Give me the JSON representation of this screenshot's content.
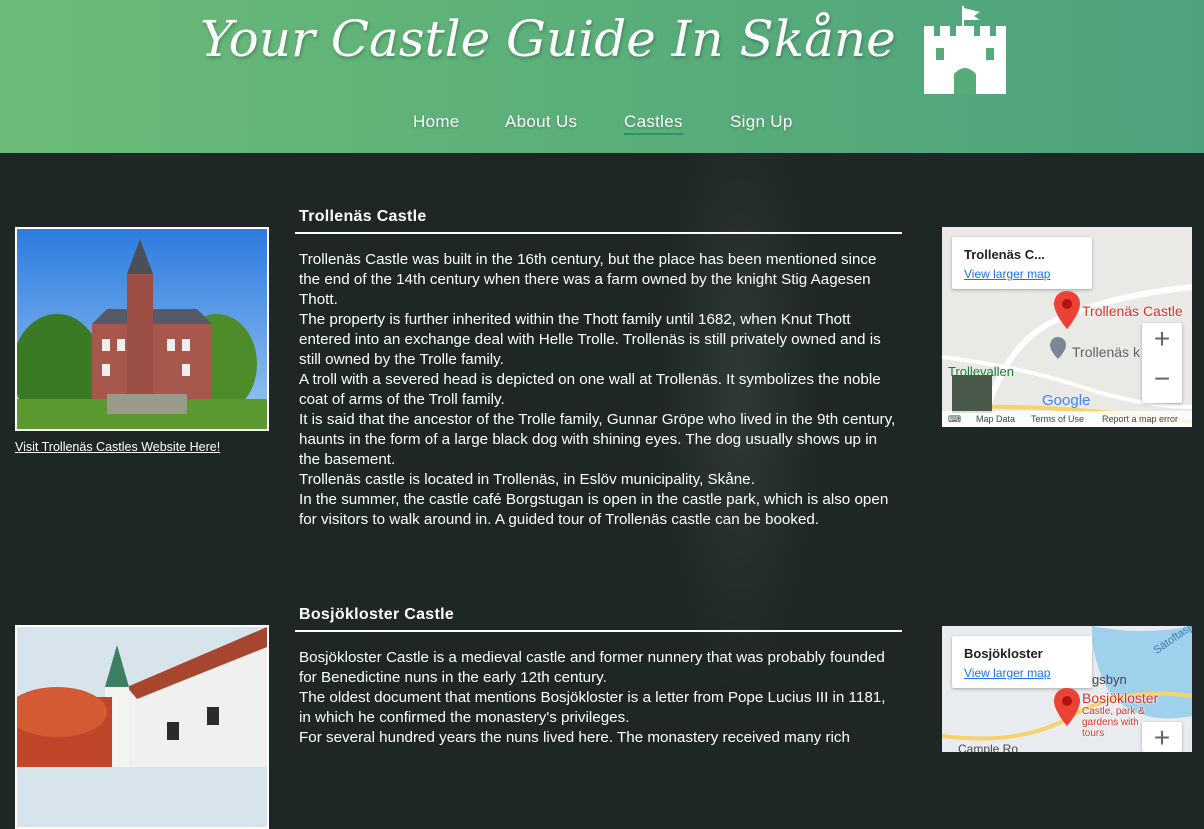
{
  "site": {
    "title": "Your Castle Guide In Skåne"
  },
  "nav": {
    "items": [
      "Home",
      "About Us",
      "Castles",
      "Sign Up"
    ],
    "active": "Castles"
  },
  "castles": [
    {
      "name": "Trollenäs Castle",
      "link": "Visit Trollenäs Castles Website Here!",
      "paragraphs": [
        "Trollenäs Castle was built in the 16th century, but the place has been mentioned since the end of the 14th century when there was a farm owned by the knight Stig Aagesen Thott.",
        "The property is further inherited within the Thott family until 1682, when Knut Thott entered into an exchange deal with Helle Trolle. Trollenäs is still privately owned and is still owned by the Trolle family.",
        "A troll with a severed head is depicted on one wall at Trollenäs. It symbolizes the noble coat of arms of the Troll family.",
        "It is said that the ancestor of the Trolle family, Gunnar Gröpe who lived in the 9th century, haunts in the form of a large black dog with shining eyes. The dog usually shows up in the basement.",
        "Trollenäs castle is located in Trollenäs, in Eslöv municipality, Skåne.",
        "In the summer, the castle café Borgstugan is open in the castle park, which is also open for visitors to walk around in. A guided tour of Trollenäs castle can be booked."
      ],
      "map": {
        "card_title": "Trollenäs C...",
        "card_link": "View larger map",
        "pin_label": "Trollenäs Castle",
        "poi_label": "Trollenäs k",
        "place_label": "Trollevallen",
        "google": "Google",
        "footer": [
          "Map Data",
          "Terms of Use",
          "Report a map error"
        ],
        "zoom_in": "+",
        "zoom_out": "−"
      }
    },
    {
      "name": "Bosjökloster Castle",
      "paragraphs": [
        "Bosjökloster Castle is a medieval castle and former nunnery that was probably founded for Benedictine nuns in the early 12th century.",
        "The oldest document that mentions Bosjökloster is a letter from Pope Lucius III in 1181, in which he confirmed the monastery's privileges.",
        "For several hundred years the nuns lived here. The monastery received many rich"
      ],
      "map": {
        "card_title": "Bosjökloster",
        "card_link": "View larger map",
        "pin_label": "Bosjökloster",
        "pin_sub": "Castle, park & gardens with tours",
        "place_label_1": "Sätoftasjön",
        "place_label_2": "gsbyn",
        "place_label_3": "Cample Ro",
        "zoom_in": "+"
      }
    }
  ],
  "colors": {
    "header_start": "#6cbb78",
    "header_end": "#4da27d",
    "page_bg": "#1f2726",
    "pin": "#ea4335"
  }
}
